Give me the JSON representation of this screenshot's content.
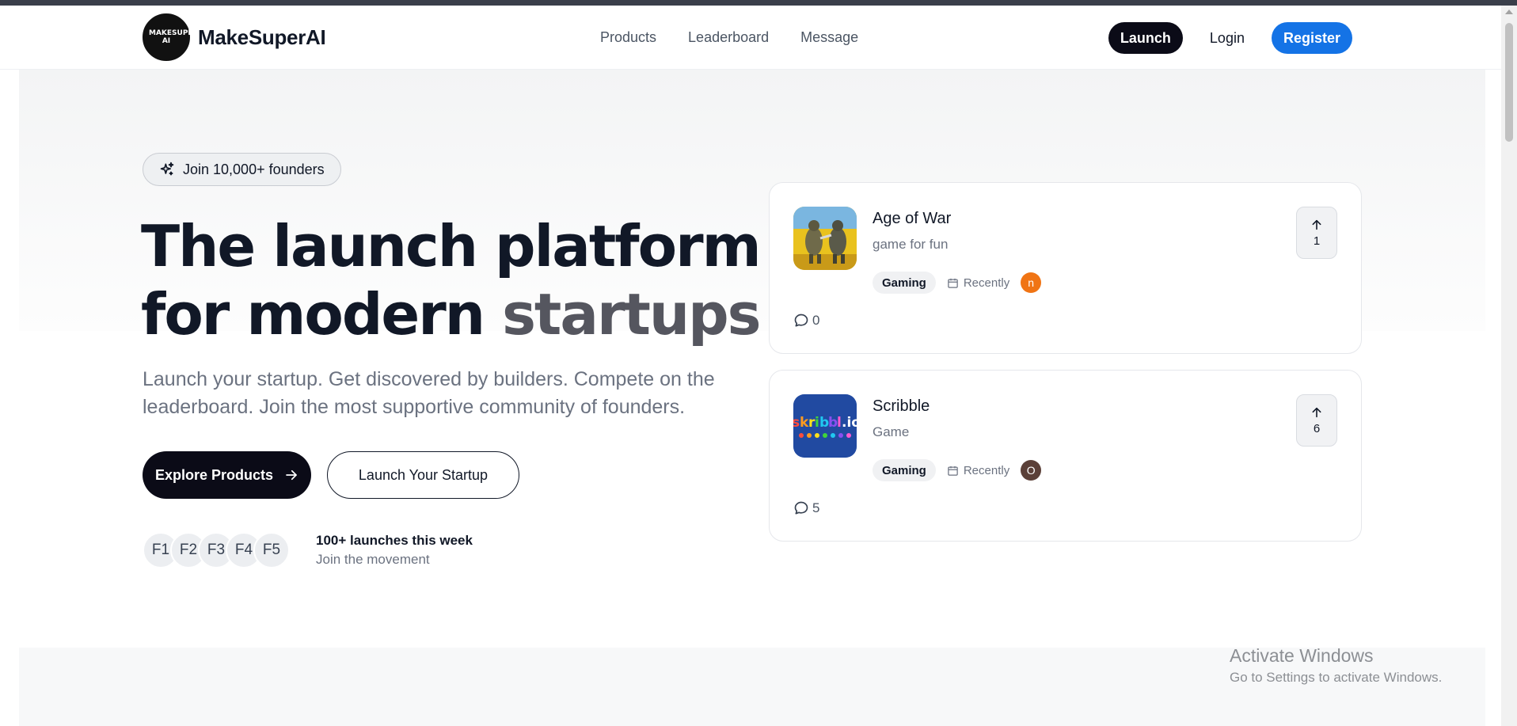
{
  "header": {
    "logo_text": "MAKESUPER AI",
    "brand": "MakeSuperAI",
    "nav": [
      "Products",
      "Leaderboard",
      "Message"
    ],
    "launch_label": "Launch",
    "login_label": "Login",
    "register_label": "Register"
  },
  "hero": {
    "badge": "Join 10,000+ founders",
    "headline_line1": "The launch platform",
    "headline_line2_dark": "for modern",
    "headline_line2_light": "startups",
    "subtitle": "Launch your startup. Get discovered by builders. Compete on the leaderboard. Join the most supportive community of founders.",
    "explore_label": "Explore Products",
    "startup_label": "Launch Your Startup",
    "founders": [
      "F1",
      "F2",
      "F3",
      "F4",
      "F5"
    ],
    "launches_title": "100+ launches this week",
    "launches_sub": "Join the movement"
  },
  "products": [
    {
      "title": "Age of War",
      "desc": "game for fun",
      "tag": "Gaming",
      "when": "Recently",
      "avatar_letter": "n",
      "avatar_color": "#f07414",
      "comments": "0",
      "votes": "1"
    },
    {
      "title": "Scribble",
      "desc": "Game",
      "tag": "Gaming",
      "when": "Recently",
      "avatar_letter": "O",
      "avatar_color": "#5b4038",
      "comments": "5",
      "votes": "6"
    }
  ],
  "watermark": {
    "line1": "Activate Windows",
    "line2": "Go to Settings to activate Windows."
  }
}
